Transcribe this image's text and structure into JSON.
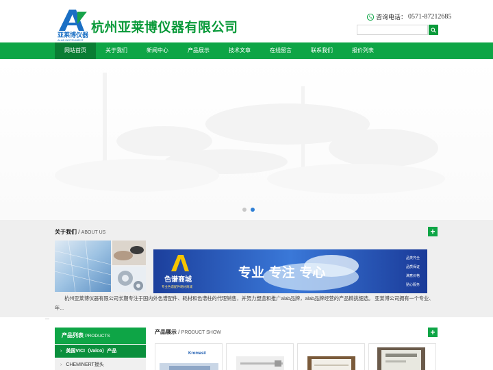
{
  "header": {
    "company_name": "杭州亚莱博仪器有限公司",
    "logo_text": "亚莱博仪器",
    "logo_sub": "ALAB INSTRUMENT",
    "phone_label": "咨询电话：",
    "phone_number": "0571-87212685",
    "search_placeholder": ""
  },
  "nav": {
    "items": [
      "网站首页",
      "关于我们",
      "新闻中心",
      "产品展示",
      "技术文章",
      "在线留言",
      "联系我们",
      "报价列表"
    ],
    "active_index": 0
  },
  "banner": {
    "slide_count": 2,
    "active_slide": 1
  },
  "about": {
    "title_cn": "关于我们",
    "title_en": "ABOUT US",
    "banner_cn": "色谱商城",
    "banner_sub": "专业色谱配件耗材商城",
    "banner_slogan": "专业  专注  专心",
    "banner_tags": [
      "品类齐全",
      "品质保证",
      "满意价格",
      "贴心服务"
    ],
    "intro": "杭州亚莱博仪器有限公司长期专注于国内外色谱配件、耗材和色谱柱的代理销售，并努力塑造和推广alab品牌，alab品牌经营的产品精挑细选。 亚莱博公司拥有一个专业、年...",
    "more": "..."
  },
  "products": {
    "side_title_cn": "产品列表",
    "side_title_en": "PRODUCTS",
    "side_items": [
      "美国VICI（Valco）产品",
      "CHEMINERT接头"
    ],
    "title_cn": "产品展示",
    "title_en": "PRODUCT SHOW",
    "card1_brand": "Kromasil"
  },
  "colors": {
    "brand_green": "#0ea546",
    "nav_active": "#0a7d34",
    "dot_active": "#2f7fd5"
  }
}
